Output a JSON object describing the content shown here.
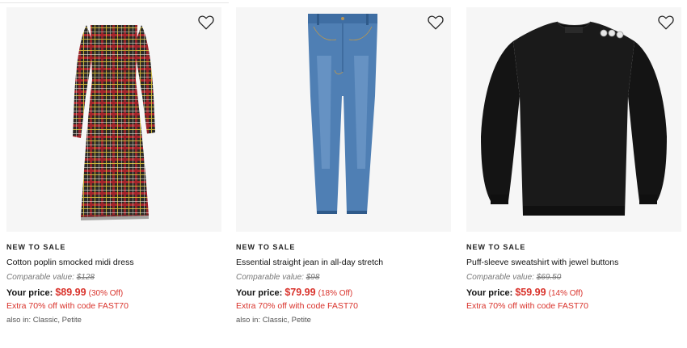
{
  "products": [
    {
      "tag": "NEW TO SALE",
      "title": "Cotton poplin smocked midi dress",
      "comparable_label": "Comparable value:",
      "comparable_price": "$128",
      "your_price_label": "Your price:",
      "price": "$89.99",
      "discount": "(30% Off)",
      "promo": "Extra 70% off with code FAST70",
      "also_in": "also in: Classic, Petite",
      "icon": "plaid-dress-image"
    },
    {
      "tag": "NEW TO SALE",
      "title": "Essential straight jean in all-day stretch",
      "comparable_label": "Comparable value:",
      "comparable_price": "$98",
      "your_price_label": "Your price:",
      "price": "$79.99",
      "discount": "(18% Off)",
      "promo": "Extra 70% off with code FAST70",
      "also_in": "also in: Classic, Petite",
      "icon": "denim-jean-image"
    },
    {
      "tag": "NEW TO SALE",
      "title": "Puff-sleeve sweatshirt with jewel buttons",
      "comparable_label": "Comparable value:",
      "comparable_price": "$69.50",
      "your_price_label": "Your price:",
      "price": "$59.99",
      "discount": "(14% Off)",
      "promo": "Extra 70% off with code FAST70",
      "also_in": "",
      "icon": "black-sweatshirt-image"
    }
  ],
  "colors": {
    "sale_red": "#d9322b",
    "image_bg": "#f6f6f6",
    "denim": "#4f7fb4",
    "sweatshirt": "#141414"
  }
}
